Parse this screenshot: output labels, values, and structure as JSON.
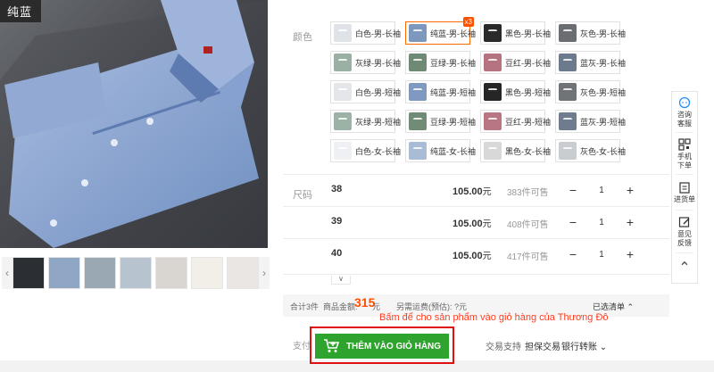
{
  "gallery": {
    "color_tag": "纯蓝",
    "prev": "‹",
    "next": "›",
    "thumb_colors": [
      "#2b2e33",
      "#8fa6c4",
      "#9aa8b4",
      "#b7c3cf",
      "#d9d6d2",
      "#f2efe9",
      "#e9e6e4",
      "#dfe3e8"
    ]
  },
  "colors": {
    "label": "颜色",
    "items": [
      {
        "label": "白色-男-长袖",
        "swatch": "#dfe3e8"
      },
      {
        "label": "纯蓝-男-长袖",
        "swatch": "#7d97bf",
        "selected": true,
        "badge": "x3"
      },
      {
        "label": "黑色-男-长袖",
        "swatch": "#2a2a2a"
      },
      {
        "label": "灰色-男-长袖",
        "swatch": "#6a6d72"
      },
      {
        "label": "灰绿-男-长袖",
        "swatch": "#9ab0a4"
      },
      {
        "label": "豆绿-男-长袖",
        "swatch": "#6f8a74"
      },
      {
        "label": "豆红-男-长袖",
        "swatch": "#b57380"
      },
      {
        "label": "蓝灰-男-长袖",
        "swatch": "#6b7a8c"
      },
      {
        "label": "白色-男-短袖",
        "swatch": "#e4e6ea"
      },
      {
        "label": "纯蓝-男-短袖",
        "swatch": "#7f99c0"
      },
      {
        "label": "黑色-男-短袖",
        "swatch": "#262626"
      },
      {
        "label": "灰色-男-短袖",
        "swatch": "#707378"
      },
      {
        "label": "灰绿-男-短袖",
        "swatch": "#9db2a6"
      },
      {
        "label": "豆绿-男-短袖",
        "swatch": "#718c76"
      },
      {
        "label": "豆红-男-短袖",
        "swatch": "#b87682"
      },
      {
        "label": "蓝灰-男-短袖",
        "swatch": "#6e7c8d"
      },
      {
        "label": "白色-女-长袖",
        "swatch": "#eef0f3"
      },
      {
        "label": "纯蓝-女-长袖",
        "swatch": "#a8bcd6"
      },
      {
        "label": "黑色-女-长袖",
        "swatch": "#d8d8d8"
      },
      {
        "label": "灰色-女-长袖",
        "swatch": "#c9ccd0"
      }
    ]
  },
  "sizes": {
    "label": "尺码",
    "rows": [
      {
        "size": "38",
        "price": "105.00",
        "unit": "元",
        "stock": "383件可售",
        "qty": "1"
      },
      {
        "size": "39",
        "price": "105.00",
        "unit": "元",
        "stock": "408件可售",
        "qty": "1"
      },
      {
        "size": "40",
        "price": "105.00",
        "unit": "元",
        "stock": "417件可售",
        "qty": "1"
      }
    ],
    "minus": "−",
    "plus": "+",
    "collapse": "∨"
  },
  "summary": {
    "total_count": "合计3件",
    "amount_label": "商品金额:",
    "amount": "315",
    "amount_unit": "元",
    "shipping": "另需运费(预估): ?元",
    "chosen": "已选清单 ⌃"
  },
  "note": "Bấm để cho sản phẩm vào giỏ hàng của Thương Đô",
  "cart": {
    "pay_label": "支付",
    "button": "THÊM VÀO GIỎ HÀNG"
  },
  "trade": {
    "support": "交易支持",
    "guarantee": "担保交易",
    "bank": "银行转账 ⌄"
  },
  "sidebar": {
    "consult": [
      "咨询",
      "客服"
    ],
    "mobile": [
      "手机",
      "下单"
    ],
    "list": [
      "进货单"
    ],
    "feedback": [
      "意见",
      "反馈"
    ],
    "top": "⌃"
  },
  "accent": {
    "orange": "#ff5000",
    "green": "#2ea32e",
    "red_frame": "#e01010"
  }
}
